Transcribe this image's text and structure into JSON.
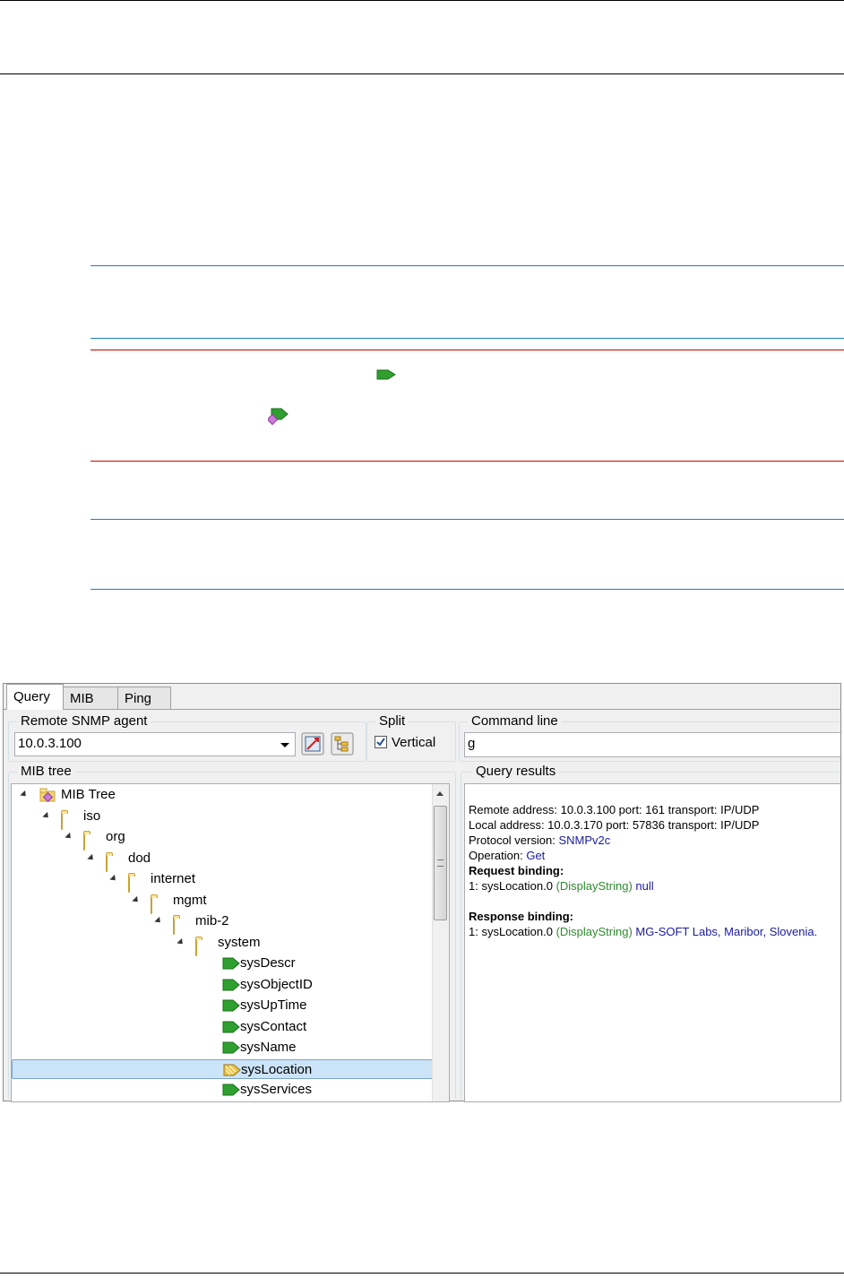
{
  "app": {
    "tabs": [
      {
        "label": "Query",
        "active": true
      },
      {
        "label": "MIB",
        "active": false
      },
      {
        "label": "Ping",
        "active": false
      }
    ],
    "agent": {
      "legend": "Remote SNMP agent",
      "value": "10.0.3.100"
    },
    "split": {
      "legend": "Split",
      "checkbox_label": "Vertical",
      "checked": true
    },
    "command": {
      "legend": "Command line",
      "value": "g"
    },
    "mib_tree": {
      "legend": "MIB tree",
      "nodes": [
        {
          "label": "MIB Tree",
          "level": 0,
          "icon": "mib-root-icon",
          "expanded": true
        },
        {
          "label": "iso",
          "level": 1,
          "icon": "folder-icon",
          "expanded": true
        },
        {
          "label": "org",
          "level": 2,
          "icon": "folder-icon",
          "expanded": true
        },
        {
          "label": "dod",
          "level": 3,
          "icon": "folder-icon",
          "expanded": true
        },
        {
          "label": "internet",
          "level": 4,
          "icon": "folder-icon",
          "expanded": true
        },
        {
          "label": "mgmt",
          "level": 5,
          "icon": "folder-icon",
          "expanded": true
        },
        {
          "label": "mib-2",
          "level": 6,
          "icon": "folder-icon",
          "expanded": true
        },
        {
          "label": "system",
          "level": 7,
          "icon": "folder-icon",
          "expanded": true
        },
        {
          "label": "sysDescr",
          "level": 8,
          "icon": "scalar-leaf-icon"
        },
        {
          "label": "sysObjectID",
          "level": 8,
          "icon": "scalar-leaf-icon"
        },
        {
          "label": "sysUpTime",
          "level": 8,
          "icon": "scalar-leaf-icon"
        },
        {
          "label": "sysContact",
          "level": 8,
          "icon": "scalar-leaf-icon"
        },
        {
          "label": "sysName",
          "level": 8,
          "icon": "scalar-leaf-icon"
        },
        {
          "label": "sysLocation",
          "level": 8,
          "icon": "selected-leaf-icon",
          "selected": true
        },
        {
          "label": "sysServices",
          "level": 8,
          "icon": "scalar-leaf-icon"
        }
      ]
    },
    "results": {
      "legend": "Query results",
      "remote": "Remote address: 10.0.3.100  port: 161 transport: IP/UDP",
      "local": "Local address: 10.0.3.170  port: 57836 transport: IP/UDP",
      "protocol_label": "Protocol version: ",
      "protocol_value": "SNMPv2c",
      "operation_label": "Operation: ",
      "operation_value": "Get",
      "request_heading": "Request binding:",
      "request_prefix": "1: sysLocation.0 ",
      "request_type": "(DisplayString)",
      "request_value": " null",
      "response_heading": "Response binding:",
      "response_prefix": "1: sysLocation.0 ",
      "response_type": "(DisplayString)",
      "response_value": " MG-SOFT Labs, Maribor, Slovenia."
    }
  },
  "colors": {
    "selection": "#cce4f7",
    "value_blue": "#1a1aa0",
    "type_green": "#2e8b2e",
    "note_blue": "#1f7fc4",
    "note_red": "#cc0000"
  }
}
